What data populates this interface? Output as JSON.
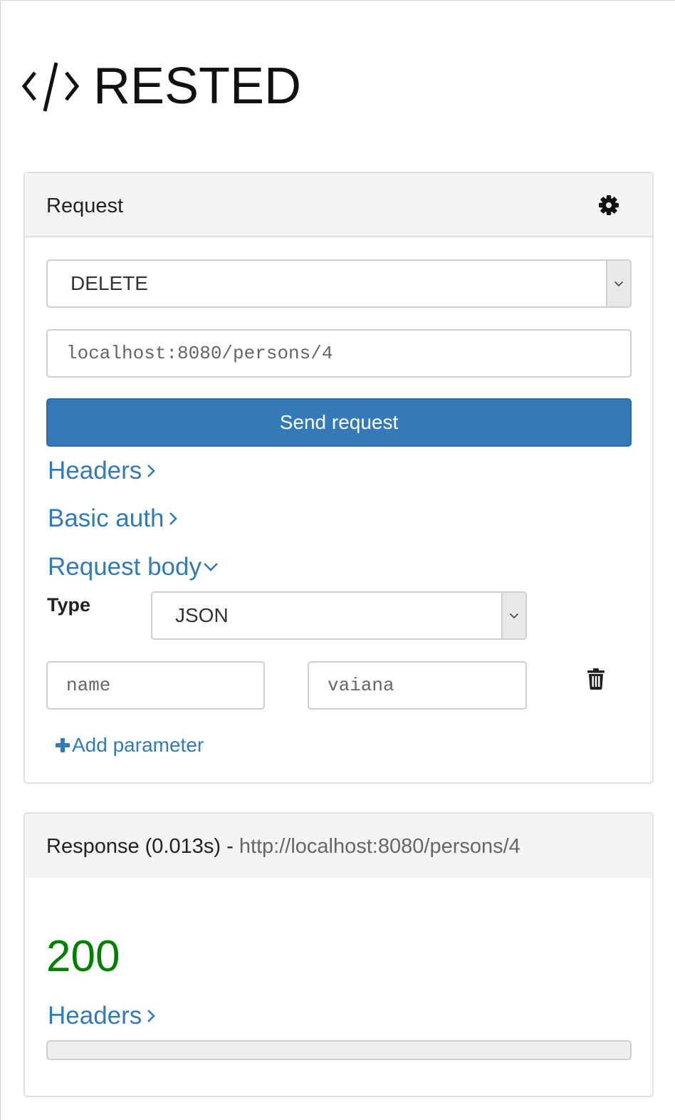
{
  "app": {
    "title": "RESTED",
    "logo_icon": "code-brackets-icon"
  },
  "request": {
    "heading": "Request",
    "settings_icon": "gear-icon",
    "method": "DELETE",
    "url": "localhost:8080/persons/4",
    "send_label": "Send request",
    "headers_link": "Headers",
    "basic_auth_link": "Basic auth",
    "body_link": "Request body",
    "body": {
      "type_label": "Type",
      "type_value": "JSON",
      "params": [
        {
          "name": "name",
          "value": "vaiana"
        }
      ],
      "add_param_label": "Add parameter"
    }
  },
  "response": {
    "heading_prefix": "Response (0.013s) - ",
    "url": "http://localhost:8080/persons/4",
    "status": "200",
    "headers_link": "Headers"
  },
  "colors": {
    "link": "#337ab7",
    "primary_button": "#337ab7",
    "status_ok": "#008000"
  }
}
